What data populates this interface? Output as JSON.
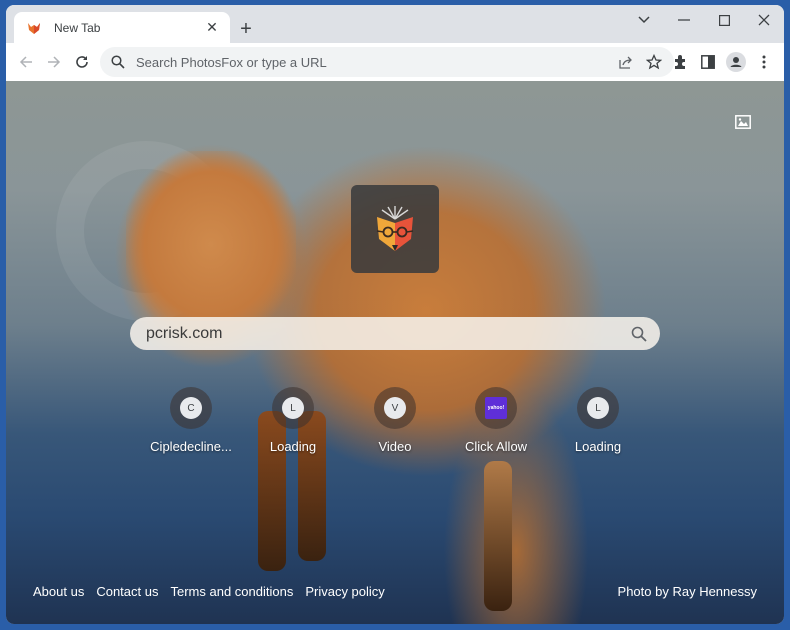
{
  "browser": {
    "tab": {
      "title": "New Tab",
      "favicon": "photosfox-favicon"
    },
    "new_tab_label": "+",
    "window_controls": [
      "tab-search",
      "minimize",
      "maximize",
      "close"
    ],
    "omnibox": {
      "placeholder": "Search PhotosFox or type a URL",
      "value": ""
    },
    "toolbar_icons": [
      "share-icon",
      "bookmark-star-icon",
      "extensions-icon",
      "side-panel-icon",
      "profile-icon",
      "menu-icon"
    ]
  },
  "page": {
    "background_toggle_icon": "image-icon",
    "logo": "photosfox-logo",
    "search": {
      "value": "pcrisk.com",
      "placeholder": ""
    },
    "shortcuts": [
      {
        "label": "Cipledecline...",
        "letter": "C"
      },
      {
        "label": "Loading",
        "letter": "L"
      },
      {
        "label": "Video",
        "letter": "V"
      },
      {
        "label": "Click Allow",
        "letter": "",
        "icon_text": "yahoo!",
        "icon_color": "#5f2fd8"
      },
      {
        "label": "Loading",
        "letter": "L"
      }
    ],
    "footer": {
      "links": [
        "About us",
        "Contact us",
        "Terms and conditions",
        "Privacy policy"
      ],
      "photo_credit": "Photo by Ray Hennessy"
    }
  },
  "colors": {
    "frame": "#2a5ea8",
    "tabstrip": "#dee1e6",
    "toolbar": "#ffffff",
    "omnibox": "#f1f3f4",
    "yahoo_purple": "#5f2fd8"
  }
}
